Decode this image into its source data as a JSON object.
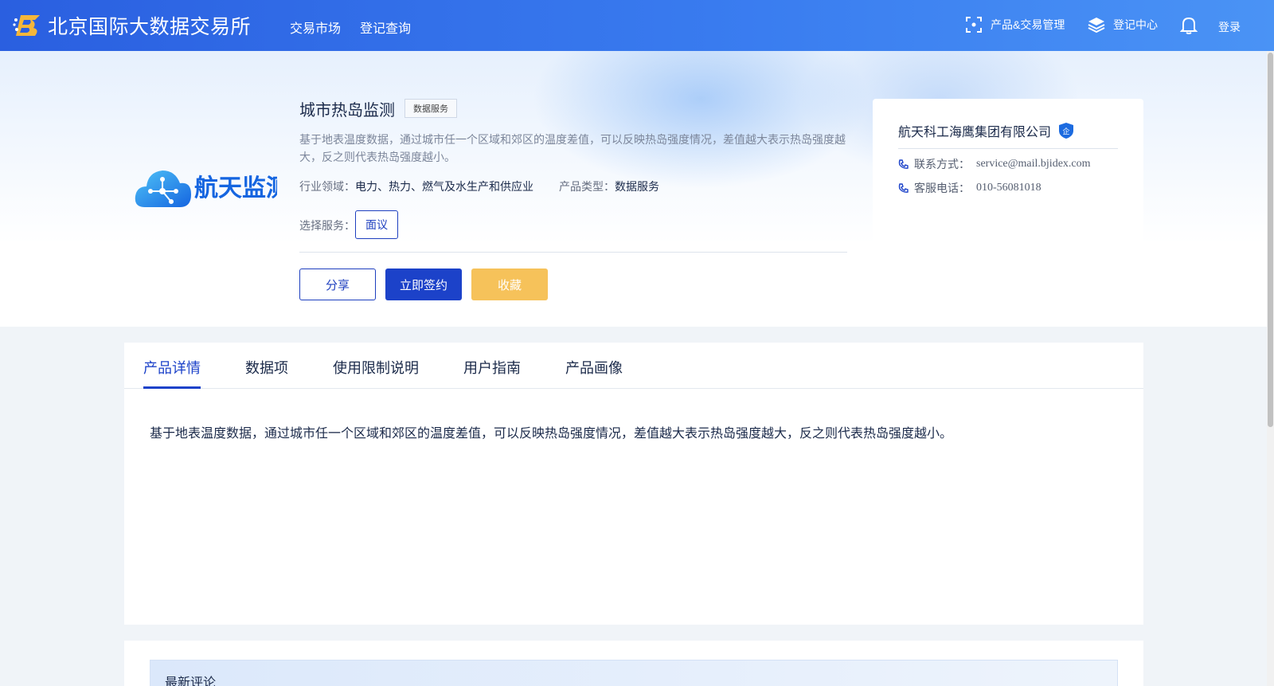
{
  "header": {
    "site_title": "北京国际大数据交易所",
    "nav": [
      "交易市场",
      "登记查询"
    ],
    "right": {
      "product_mgmt": "产品&交易管理",
      "register_center": "登记中心",
      "login": "登录"
    },
    "icons": [
      "scan-icon",
      "layers-icon",
      "bell-icon"
    ]
  },
  "product": {
    "logo_text": "航天监测",
    "title": "城市热岛监测",
    "tag": "数据服务",
    "description": "基于地表温度数据，通过城市任一个区域和郊区的温度差值，可以反映热岛强度情况，差值越大表示热岛强度越大，反之则代表热岛强度越小。",
    "industry_label": "行业领域：",
    "industry_value": "电力、热力、燃气及水生产和供应业",
    "type_label": "产品类型：",
    "type_value": "数据服务",
    "service_label": "选择服务：",
    "service_option": "面议",
    "buttons": {
      "share": "分享",
      "sign": "立即签约",
      "favorite": "收藏"
    }
  },
  "company": {
    "name": "航天科工海鹰集团有限公司",
    "badge": "企",
    "contact_label": "联系方式：",
    "contact_value": "service@mail.bjidex.com",
    "phone_label": "客服电话：",
    "phone_value": "010-56081018"
  },
  "tabs": {
    "items": [
      "产品详情",
      "数据项",
      "使用限制说明",
      "用户指南",
      "产品画像"
    ],
    "active": 0
  },
  "detail": {
    "text": "基于地表温度数据，通过城市任一个区域和郊区的温度差值，可以反映热岛强度情况，差值越大表示热岛强度越大，反之则代表热岛强度越小。"
  },
  "comments": {
    "title": "最新评论"
  },
  "colors": {
    "primary": "#1c42c9",
    "header": "#2a5fe0",
    "favorite": "#f6c25a"
  }
}
